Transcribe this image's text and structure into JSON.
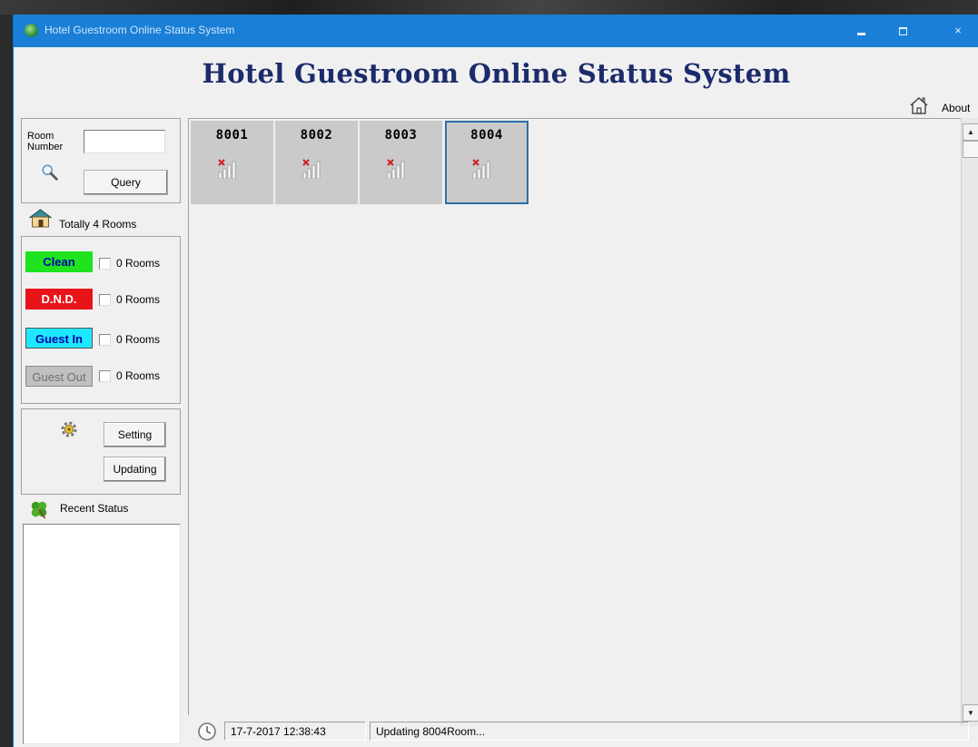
{
  "window": {
    "title": "Hotel Guestroom Online Status System",
    "minimize": "",
    "maximize": "",
    "close": "×"
  },
  "header": {
    "title": "Hotel Guestroom Online Status System",
    "about_label": "About"
  },
  "query": {
    "room_number_label": "Room\nNumber",
    "room_number_value": "",
    "query_button": "Query"
  },
  "summary": {
    "total_label": "Totally 4 Rooms"
  },
  "legend": [
    {
      "label": "Clean",
      "count": "0 Rooms",
      "checked": false,
      "color": "#1ee31e",
      "text_color": "#0000aa"
    },
    {
      "label": "D.N.D.",
      "count": "0 Rooms",
      "checked": false,
      "color": "#e8141a",
      "text_color": "#ffffff"
    },
    {
      "label": "Guest In",
      "count": "0 Rooms",
      "checked": false,
      "color": "#1ee8ff",
      "text_color": "#0000aa"
    },
    {
      "label": "Guest Out",
      "count": "0 Rooms",
      "checked": false,
      "color": "#c0c0c0",
      "text_color": "#6f6f6f"
    }
  ],
  "settings": {
    "setting_button": "Setting",
    "updating_button": "Updating"
  },
  "recent": {
    "label": "Recent Status",
    "items": []
  },
  "rooms": [
    {
      "number": "8001",
      "signal_icon": "no-signal-icon",
      "selected": false
    },
    {
      "number": "8002",
      "signal_icon": "no-signal-icon",
      "selected": false
    },
    {
      "number": "8003",
      "signal_icon": "no-signal-icon",
      "selected": false
    },
    {
      "number": "8004",
      "signal_icon": "no-signal-icon",
      "selected": true
    }
  ],
  "status_bar": {
    "datetime": "17-7-2017 12:38:43",
    "message": "Updating 8004Room..."
  },
  "colors": {
    "titlebar": "#1a7fd6",
    "app_title": "#1b2b6b",
    "tile": "#cacaca",
    "tile_selected_border": "#2f6ea6"
  }
}
